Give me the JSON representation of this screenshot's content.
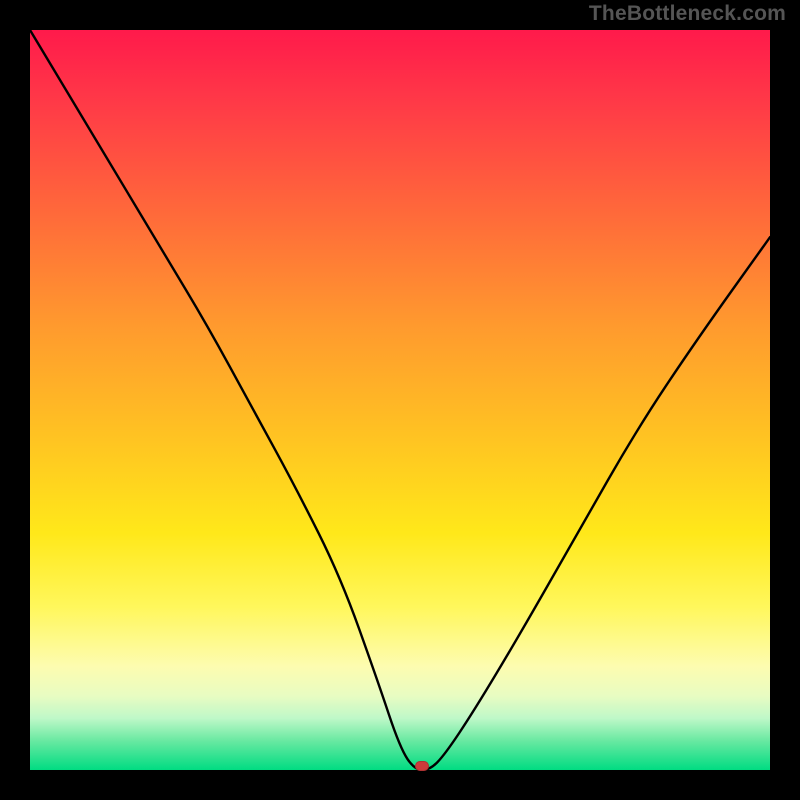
{
  "watermark": "TheBottleneck.com",
  "chart_data": {
    "type": "line",
    "title": "",
    "xlabel": "",
    "ylabel": "",
    "xlim": [
      0,
      100
    ],
    "ylim": [
      0,
      100
    ],
    "grid": false,
    "series": [
      {
        "name": "bottleneck-curve",
        "x": [
          0,
          6,
          12,
          18,
          24,
          30,
          36,
          42,
          47,
          50,
          52,
          54,
          56,
          60,
          66,
          74,
          82,
          90,
          100
        ],
        "values": [
          100,
          90,
          80,
          70,
          60,
          49,
          38,
          26,
          12,
          3,
          0,
          0,
          2,
          8,
          18,
          32,
          46,
          58,
          72
        ]
      }
    ],
    "marker": {
      "name": "bottleneck-point",
      "x": 53,
      "y": 0.5
    },
    "gradient_stops": [
      {
        "color": "#ff1a4b",
        "pos": 0
      },
      {
        "color": "#ffe81a",
        "pos": 68
      },
      {
        "color": "#00dc82",
        "pos": 100
      }
    ]
  }
}
